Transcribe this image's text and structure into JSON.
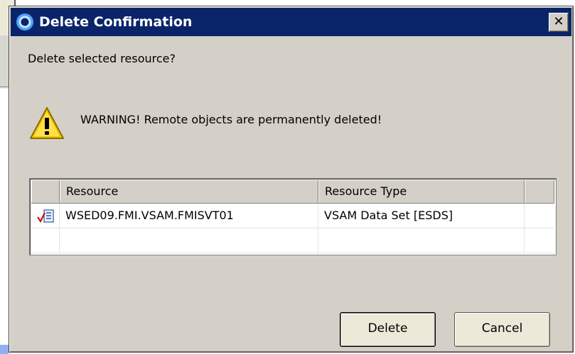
{
  "dialog": {
    "title": "Delete Confirmation",
    "close_glyph": "✕",
    "prompt": "Delete selected resource?",
    "warning": {
      "icon": "warning-triangle-icon",
      "text": "WARNING! Remote objects are permanently deleted!"
    },
    "table": {
      "columns": [
        "Resource",
        "Resource Type"
      ],
      "rows": [
        {
          "icon": "vsam-dataset-icon",
          "resource": "WSED09.FMI.VSAM.FMISVT01",
          "type": "VSAM Data Set [ESDS]"
        }
      ]
    },
    "buttons": {
      "delete": "Delete",
      "cancel": "Cancel"
    }
  },
  "colors": {
    "titlebar": "#0a246a",
    "dialog_bg": "#d4d0c8",
    "warning_yellow": "#f5c400"
  }
}
